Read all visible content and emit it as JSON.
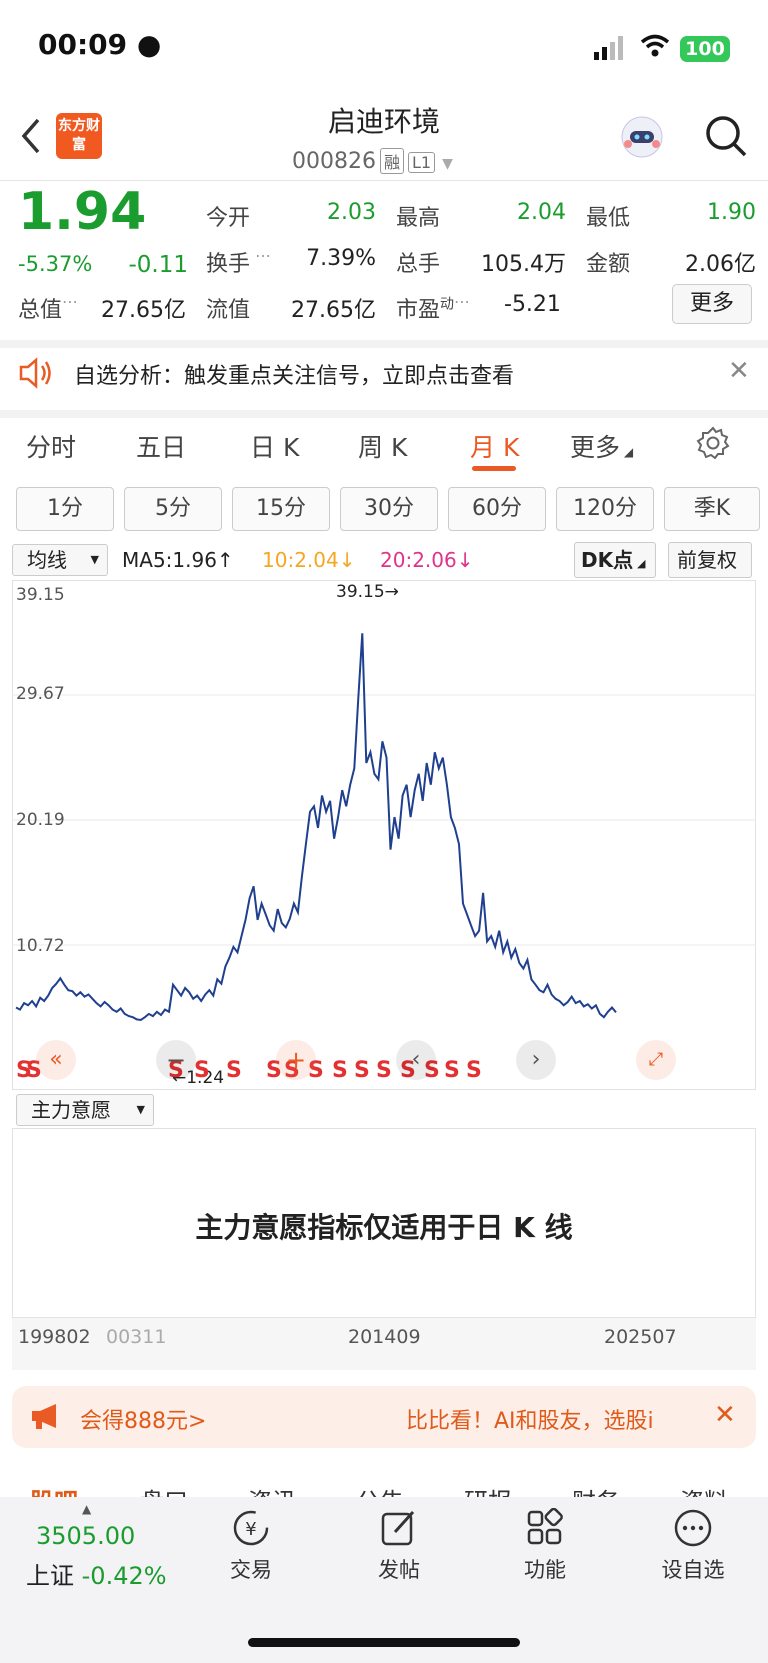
{
  "status_bar": {
    "time": "00:09",
    "battery": "100"
  },
  "header": {
    "logo": "东方财富",
    "stock_name": "启迪环境",
    "stock_code": "000826",
    "tag_margin": "融",
    "tag_level": "L1"
  },
  "quote": {
    "price": "1.94",
    "change_pct": "-5.37%",
    "change": "-0.11",
    "open_label": "今开",
    "open": "2.03",
    "high_label": "最高",
    "high": "2.04",
    "low_label": "最低",
    "low": "1.90",
    "turnover_label": "换手",
    "turnover": "7.39%",
    "volume_label": "总手",
    "volume": "105.4万",
    "amount_label": "金额",
    "amount": "2.06亿",
    "total_mv_label": "总值",
    "total_mv": "27.65亿",
    "float_mv_label": "流值",
    "float_mv": "27.65亿",
    "pe_label": "市盈",
    "pe_sup": "动",
    "pe": "-5.21",
    "more_label": "更多"
  },
  "notice": {
    "text": "自选分析：触发重点关注信号，立即点击查看"
  },
  "tabs": [
    "分时",
    "五日",
    "日 K",
    "周 K",
    "月 K",
    "更多"
  ],
  "active_tab": "月 K",
  "periods": [
    "1分",
    "5分",
    "15分",
    "30分",
    "60分",
    "120分",
    "季K"
  ],
  "chart_header": {
    "indicator": "均线",
    "ma5": "MA5:1.96↑",
    "ma10": "10:2.04↓",
    "ma20": "20:2.06↓",
    "dk": "DK点",
    "adjust": "前复权"
  },
  "colors": {
    "ma10": "#f5a623",
    "ma20": "#e0338a",
    "price_line": "#1f3f8f",
    "accent": "#ea5a24",
    "down": "#1a9c2e"
  },
  "chart_data": {
    "type": "line",
    "y_ticks": [
      "39.15",
      "29.67",
      "20.19",
      "10.72"
    ],
    "ylim": [
      1.24,
      39.15
    ],
    "x_ticks": [
      "199802",
      "00311",
      "201409",
      "202507"
    ],
    "max_label": "39.15→",
    "min_label": "←1.24",
    "series": [
      {
        "name": "",
        "values": [
          2.4,
          2.2,
          2.8,
          2.6,
          3.0,
          2.5,
          3.3,
          3.0,
          3.5,
          4.2,
          4.6,
          5.1,
          4.5,
          4.0,
          3.9,
          3.5,
          3.8,
          3.4,
          3.6,
          3.2,
          2.8,
          2.5,
          2.9,
          2.6,
          2.2,
          2.0,
          2.3,
          1.8,
          1.6,
          1.5,
          1.3,
          1.24,
          1.5,
          1.8,
          1.6,
          2.0,
          1.7,
          2.2,
          2.0,
          4.5,
          4.0,
          3.5,
          4.2,
          3.8,
          3.2,
          3.5,
          3.0,
          3.6,
          4.0,
          3.5,
          5.0,
          4.6,
          6.2,
          7.0,
          8.0,
          7.5,
          9.0,
          10.5,
          12.5,
          13.6,
          10.5,
          12.0,
          11.0,
          10.0,
          9.5,
          11.5,
          10.2,
          9.8,
          10.6,
          12.0,
          11.2,
          14.5,
          17.5,
          20.5,
          21.0,
          19.0,
          22.0,
          20.5,
          21.5,
          18.0,
          20.0,
          22.5,
          21.0,
          23.0,
          24.5,
          31.0,
          37.0,
          25.0,
          26.0,
          24.0,
          23.5,
          27.0,
          25.5,
          17.0,
          20.0,
          18.0,
          22.0,
          23.0,
          20.0,
          22.5,
          24.0,
          21.5,
          25.0,
          23.0,
          26.0,
          24.5,
          25.5,
          23.0,
          20.0,
          19.0,
          17.5,
          12.0,
          11.0,
          10.0,
          9.0,
          9.5,
          13.0,
          8.5,
          9.0,
          8.0,
          9.5,
          7.5,
          8.5,
          7.0,
          7.8,
          6.5,
          6.0,
          6.8,
          5.0,
          4.5,
          4.0,
          3.8,
          4.5,
          3.6,
          3.2,
          3.0,
          2.6,
          2.9,
          3.4,
          2.8,
          3.0,
          2.5,
          2.7,
          2.3,
          2.6,
          1.8,
          1.5,
          2.0,
          2.4,
          1.94
        ]
      }
    ],
    "signals": "S"
  },
  "sub_chart": {
    "indicator": "主力意愿",
    "message": "主力意愿指标仅适用于日 K 线"
  },
  "banner": {
    "left": "会得888元>",
    "right": "比比看！AI和股友，选股i"
  },
  "bottom_tabs": [
    "股吧",
    "盘口",
    "资讯",
    "公告",
    "研报",
    "财务",
    "资料"
  ],
  "index": {
    "value": "3505.00",
    "name": "上证",
    "change": "-0.42%"
  },
  "nav": [
    {
      "label": "交易",
      "icon": "trade-icon"
    },
    {
      "label": "发帖",
      "icon": "post-icon"
    },
    {
      "label": "功能",
      "icon": "function-icon"
    },
    {
      "label": "设自选",
      "icon": "more-icon"
    }
  ]
}
